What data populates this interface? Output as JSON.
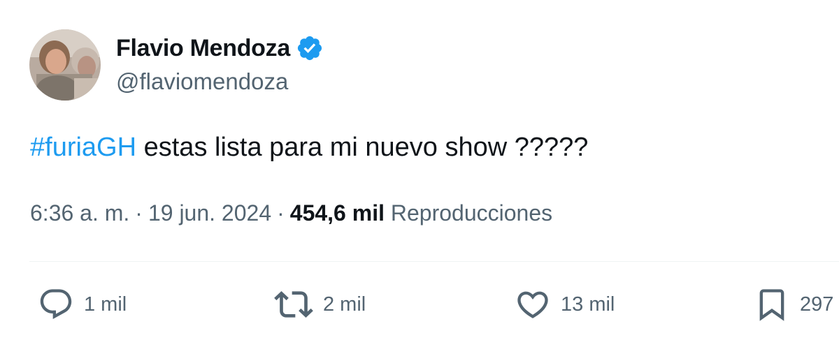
{
  "author": {
    "display_name": "Flavio Mendoza",
    "handle": "@flaviomendoza",
    "verified_color": "#1d9bf0"
  },
  "tweet": {
    "hashtag": "#furiaGH",
    "text": " estas lista para mi nuevo show ?????",
    "time": "6:36 a. m.",
    "separator": "·",
    "date": "19 jun. 2024",
    "views_count": "454,6 mil",
    "views_label": "Reproducciones"
  },
  "actions": {
    "reply_icon": "reply-icon",
    "reply_count": "1 mil",
    "retweet_icon": "retweet-icon",
    "retweet_count": "2 mil",
    "like_icon": "heart-icon",
    "like_count": "13 mil",
    "bookmark_icon": "bookmark-icon",
    "bookmark_count": "297"
  },
  "colors": {
    "text": "#0f1419",
    "secondary": "#536471",
    "link": "#1d9bf0",
    "divider": "#eff3f4"
  }
}
